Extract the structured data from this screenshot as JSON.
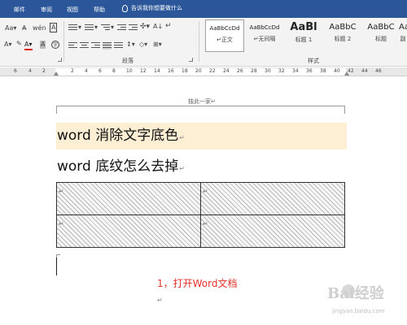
{
  "menu": {
    "tabs": [
      "邮件",
      "审阅",
      "视图",
      "帮助"
    ],
    "tell_me": "告诉我你想要做什么"
  },
  "ribbon": {
    "font_size_label": "Aa",
    "paragraph_group": "段落",
    "styles_group": "样式",
    "styles": [
      {
        "sample": "AaBbCcDd",
        "name": "↵正文"
      },
      {
        "sample": "AaBbCcDd",
        "name": "↵无间隔"
      },
      {
        "sample": "AaBl",
        "name": "标题 1"
      },
      {
        "sample": "AaBbC",
        "name": "标题 2"
      },
      {
        "sample": "AaBbC",
        "name": "标题"
      },
      {
        "sample": "AaBl",
        "name": "副"
      }
    ]
  },
  "ruler": {
    "numbers": [
      "6",
      "4",
      "2",
      "2",
      "4",
      "6",
      "8",
      "10",
      "12",
      "14",
      "16",
      "18",
      "20",
      "22",
      "24",
      "26",
      "28",
      "30",
      "32",
      "34",
      "36",
      "38",
      "40",
      "42",
      "44",
      "46"
    ]
  },
  "document": {
    "header_text": "独此一家↵",
    "heading1": "word 消除文字底色",
    "heading2": "word 底纹怎么去掉",
    "paragraph_mark": "↵",
    "cell_mark": "↵",
    "caption": "1，打开Word文档"
  },
  "watermark": {
    "logo": "Bai经验",
    "url": "jingyan.baidu.com"
  },
  "colors": {
    "title_bar": "#2b579a",
    "heading_shading": "#fdefd4",
    "caption_red": "#e0322a"
  }
}
